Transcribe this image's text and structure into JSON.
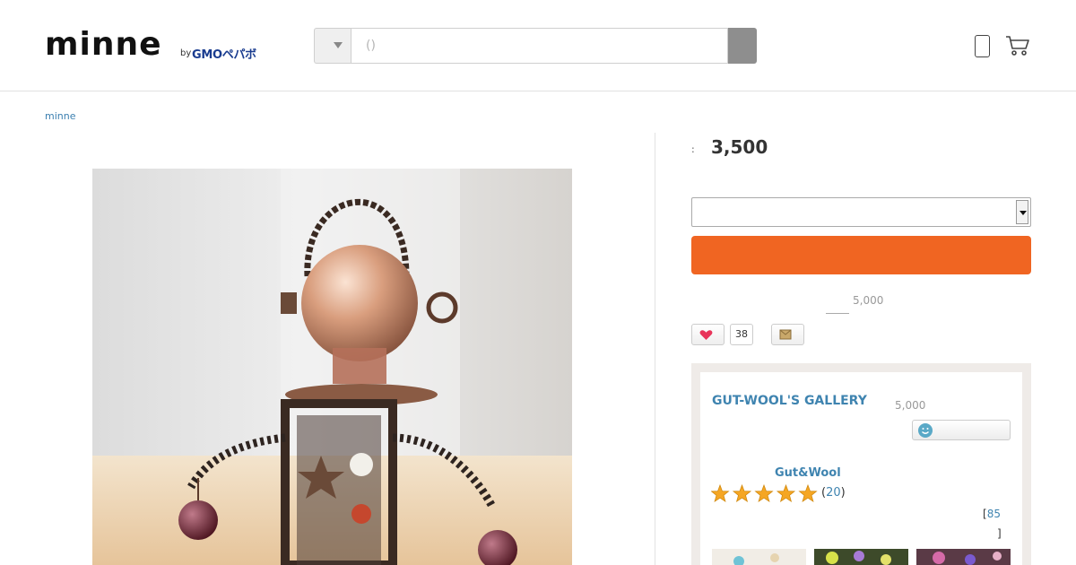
{
  "header": {
    "logo_text": "minne",
    "logo_by": "by",
    "logo_company": "GMOペパボ",
    "search_placeholder": "()",
    "icons": {
      "category_toggle": "triangle-down-icon",
      "phone": "smartphone-icon",
      "cart": "cart-icon"
    }
  },
  "breadcrumb": {
    "home": "minne"
  },
  "product": {
    "price_label": ":",
    "price": "3,500",
    "shipping_threshold": "5,000",
    "favorite_count": "38"
  },
  "shop": {
    "name": "GUT-WOOL'S GALLERY",
    "followers_note": "5,000",
    "creator_name": "Gut&Wool",
    "rating_stars": 5,
    "review_count": "20",
    "works_count": "85",
    "works_open": "[",
    "works_close": "]"
  },
  "colors": {
    "accent_link": "#3f84b0",
    "cart_button": "#f06522",
    "search_button": "#8e8e8e",
    "shop_card_bg": "#efebe8",
    "star": "#f5a623"
  }
}
